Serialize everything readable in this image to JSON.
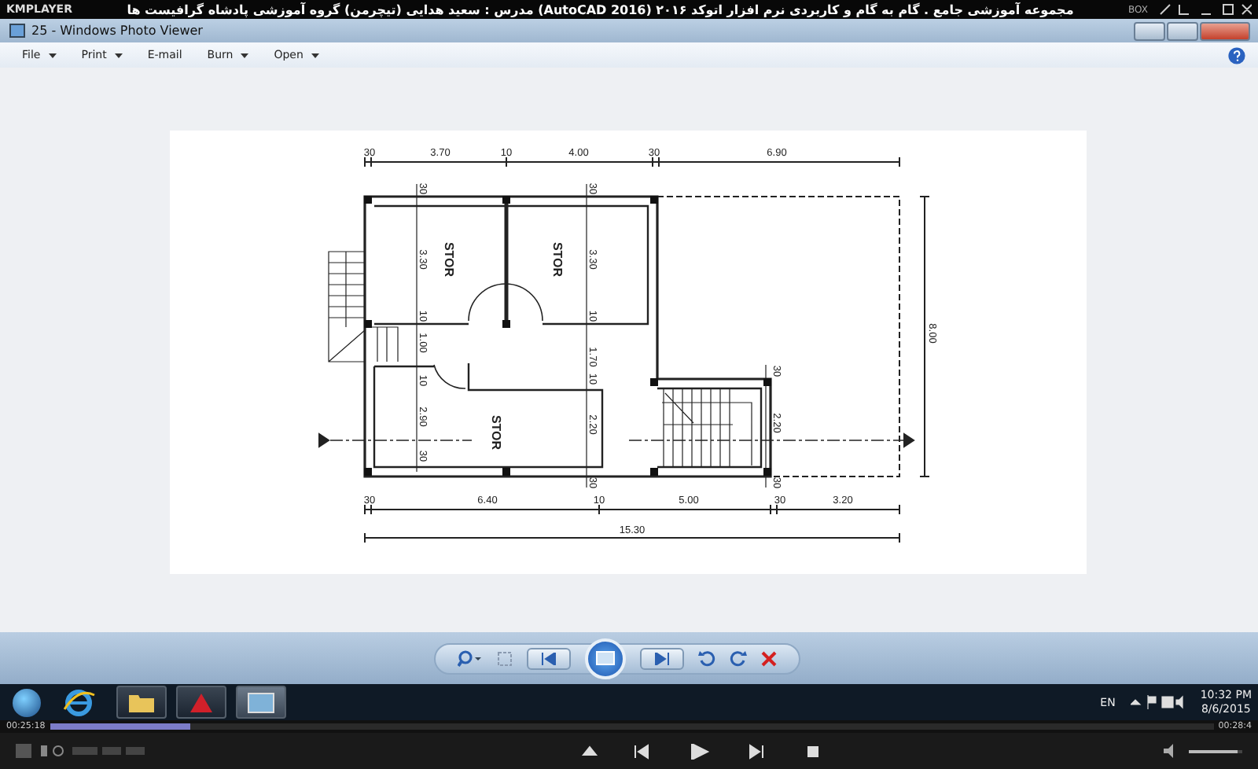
{
  "player": {
    "logo": "KMPLAYER",
    "title": "مجموعه آموزشی جامع . گام به گام و کاربردی نرم افزار اتوکد ۲۰۱۶ (AutoCAD 2016) مدرس : سعید هدایی (تیچرمن) گروه آموزشی پادشاه گرافیست ها",
    "box_label": "BOX"
  },
  "window": {
    "title": "25 - Windows Photo Viewer"
  },
  "menu": [
    {
      "label": "File",
      "dropdown": true
    },
    {
      "label": "Print",
      "dropdown": true
    },
    {
      "label": "E-mail",
      "dropdown": false
    },
    {
      "label": "Burn",
      "dropdown": true
    },
    {
      "label": "Open",
      "dropdown": true
    }
  ],
  "plan": {
    "top_dimensions": [
      "30",
      "3.70",
      "10",
      "4.00",
      "30",
      "6.90"
    ],
    "bottom_dimensions": [
      "30",
      "6.40",
      "10",
      "5.00",
      "30",
      "3.20"
    ],
    "total_dimension": "15.30",
    "height_dimension": "8.00",
    "vertical_dimensions": [
      [
        "30",
        "3.30",
        "10",
        "1.00",
        "10",
        "2.90",
        "30"
      ],
      [
        "30",
        "3.30",
        "10",
        "1.70",
        "10",
        "2.20",
        "30"
      ],
      [
        "30",
        "2.20",
        "30"
      ]
    ],
    "rooms": [
      "STOR",
      "STOR",
      "STOR"
    ]
  },
  "taskbar": {
    "language": "EN",
    "time": "10:32 PM",
    "date": "8/6/2015"
  },
  "playback": {
    "elapsed": "00:25:18",
    "total": "00:28:4",
    "level": 0.12,
    "volume": {
      "level": 0.9
    }
  }
}
